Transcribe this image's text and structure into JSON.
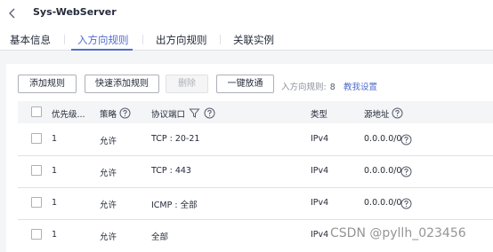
{
  "header": {
    "title": "Sys-WebServer"
  },
  "tabs": [
    {
      "label": "基本信息"
    },
    {
      "label": "入方向规则"
    },
    {
      "label": "出方向规则"
    },
    {
      "label": "关联实例"
    }
  ],
  "toolbar": {
    "add_rule": "添加规则",
    "quick_add_rule": "快速添加规则",
    "delete": "删除",
    "one_click_allow": "一键放通",
    "rule_count_label": "入方向规则:",
    "rule_count": "8",
    "teach_link": "教我设置"
  },
  "table": {
    "columns": {
      "priority": "优先级...",
      "policy": "策略",
      "protocol_port": "协议端口",
      "type": "类型",
      "source": "源地址"
    },
    "rows": [
      {
        "priority": "1",
        "policy": "允许",
        "protocol_port": "TCP : 20-21",
        "type": "IPv4",
        "source": "0.0.0.0/0"
      },
      {
        "priority": "1",
        "policy": "允许",
        "protocol_port": "TCP : 443",
        "type": "IPv4",
        "source": "0.0.0.0/0"
      },
      {
        "priority": "1",
        "policy": "允许",
        "protocol_port": "ICMP : 全部",
        "type": "IPv4",
        "source": "0.0.0.0/0"
      },
      {
        "priority": "1",
        "policy": "允许",
        "protocol_port": "全部",
        "type": "IPv4",
        "source": ""
      }
    ]
  },
  "watermark": "CSDN @pyllh_023456",
  "colors": {
    "accent": "#526ecc",
    "text": "#252b3a",
    "muted": "#8a8e99",
    "border": "#dfe1e6",
    "background": "#f4f5f7"
  },
  "icons": {
    "back": "chevron-left-icon",
    "help": "help-circle-icon",
    "filter": "filter-icon"
  }
}
